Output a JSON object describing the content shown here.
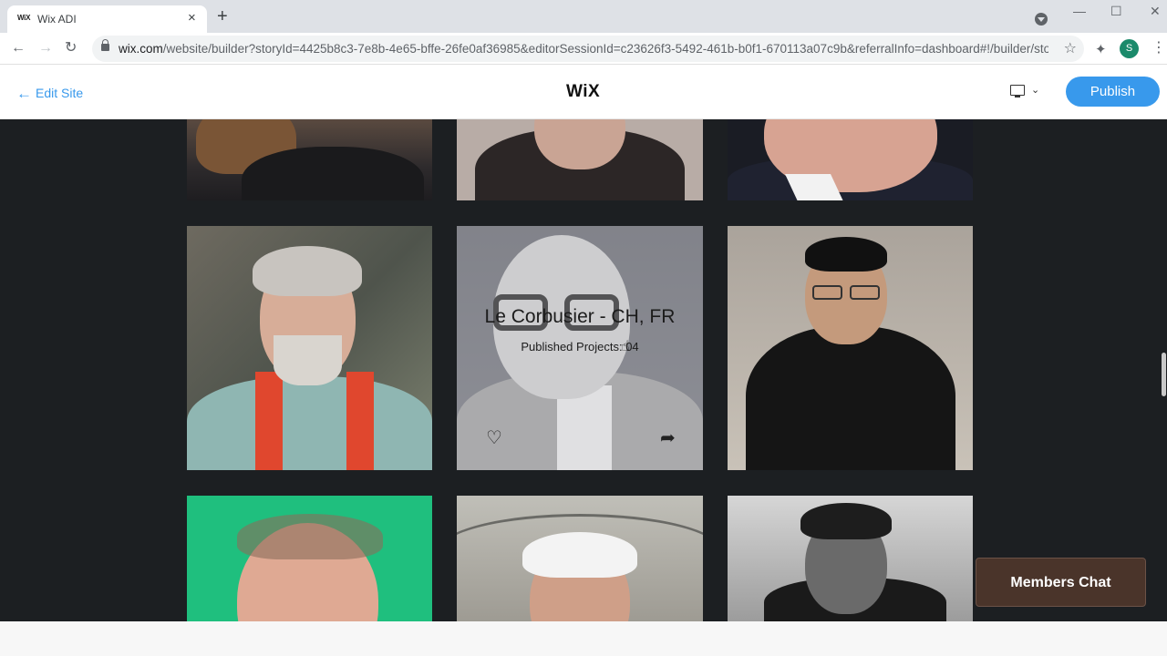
{
  "browser": {
    "tab": {
      "favicon": "WiX",
      "title": "Wix ADI",
      "close": "×"
    },
    "new_tab": "+",
    "url_main": "wix.com",
    "url_rest": "/website/builder?storyId=4425b8c3-7e8b-4e65-bffe-26fe0af36985&editorSessionId=c23626f3-5492-461b-b0f1-670113a07c9b&referralInfo=dashboard#!/builder/stor...",
    "avatar_letter": "S"
  },
  "wix_header": {
    "edit_site": "Edit Site",
    "logo": "WiX",
    "publish": "Publish"
  },
  "gallery": {
    "hover_card": {
      "name": "Le Corbusier - CH, FR",
      "meta": "Published Projects: 04"
    }
  },
  "members_chat": "Members Chat",
  "colors": {
    "accent": "#3899ec",
    "site_bg": "#1c1f22",
    "chat_bg": "#4a342a"
  }
}
